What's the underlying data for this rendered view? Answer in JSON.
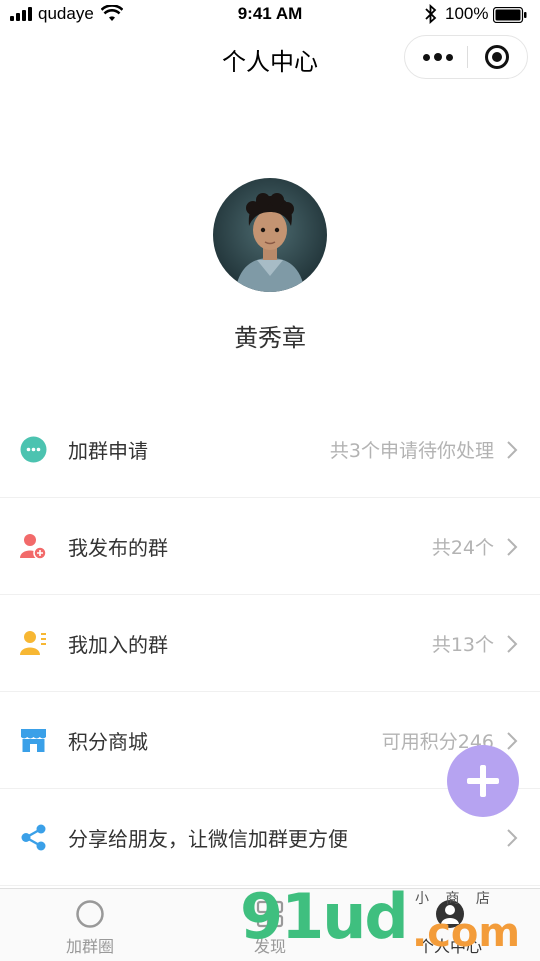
{
  "status_bar": {
    "carrier": "qudaye",
    "time": "9:41 AM",
    "battery_percent": "100%"
  },
  "nav": {
    "title": "个人中心"
  },
  "profile": {
    "name": "黄秀章"
  },
  "menu": {
    "items": [
      {
        "label": "加群申请",
        "value": "共3个申请待你处理",
        "icon": "chat-bubble-icon",
        "color": "#4cc3b0"
      },
      {
        "label": "我发布的群",
        "value": "共24个",
        "icon": "user-add-icon",
        "color": "#f26a6a"
      },
      {
        "label": "我加入的群",
        "value": "共13个",
        "icon": "user-list-icon",
        "color": "#f7b733"
      },
      {
        "label": "积分商城",
        "value": "可用积分246",
        "icon": "store-icon",
        "color": "#3aa0e8"
      },
      {
        "label": "分享给朋友，让微信加群更方便",
        "value": "",
        "icon": "share-icon",
        "color": "#3aa0e8"
      }
    ]
  },
  "tabbar": {
    "tabs": [
      {
        "label": "加群圈",
        "icon": "circle-icon"
      },
      {
        "label": "发现",
        "icon": "grid-icon"
      },
      {
        "label": "个人中心",
        "icon": "person-icon"
      }
    ]
  },
  "watermark": {
    "main": "91ud",
    "dot": ".com",
    "sub": "小 商 店"
  }
}
